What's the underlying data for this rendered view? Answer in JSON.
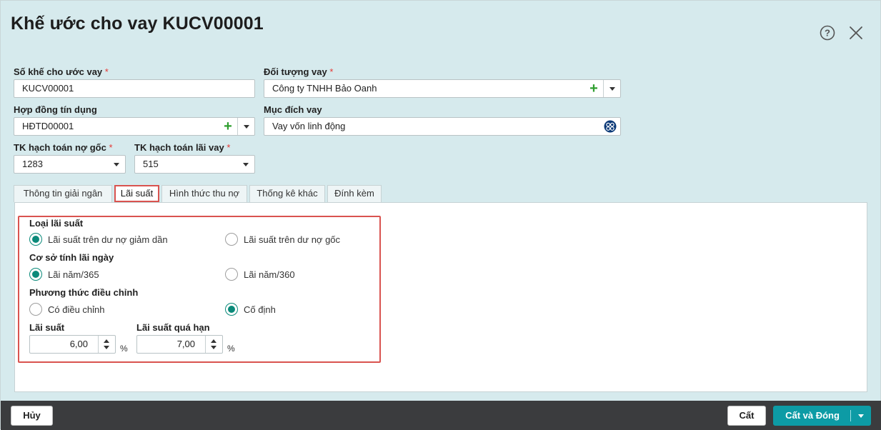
{
  "dialog": {
    "title": "Khế ước cho vay KUCV00001"
  },
  "form": {
    "so_khe_uoc": {
      "label": "Số khế cho ước vay",
      "required": "*",
      "value": "KUCV00001"
    },
    "doi_tuong_vay": {
      "label": "Đối tượng vay",
      "required": "*",
      "value": "Công ty TNHH Bảo Oanh",
      "add_glyph": "+"
    },
    "hop_dong_tin_dung": {
      "label": "Hợp đồng tín dụng",
      "value": "HĐTD00001",
      "add_glyph": "+"
    },
    "muc_dich_vay": {
      "label": "Mục đích vay",
      "value": "Vay vốn linh động"
    },
    "tk_no_goc": {
      "label": "TK hạch toán nợ gốc",
      "required": "*",
      "value": "1283"
    },
    "tk_lai_vay": {
      "label": "TK hạch toán lãi vay",
      "required": "*",
      "value": "515"
    }
  },
  "tabs": [
    {
      "label": "Thông tin giải ngân"
    },
    {
      "label": "Lãi suất"
    },
    {
      "label": "Hình thức thu nợ"
    },
    {
      "label": "Thống kê khác"
    },
    {
      "label": "Đính kèm"
    }
  ],
  "active_tab": "Lãi suất",
  "interest": {
    "loai_lai_suat": {
      "label": "Loại lãi suất",
      "options": [
        "Lãi suất trên dư nợ giảm dần",
        "Lãi suất trên dư nợ gốc"
      ],
      "selected": "Lãi suất trên dư nợ giảm dần"
    },
    "co_so_tinh_lai": {
      "label": "Cơ sở tính lãi ngày",
      "options": [
        "Lãi năm/365",
        "Lãi năm/360"
      ],
      "selected": "Lãi năm/365"
    },
    "phuong_thuc_dieu_chinh": {
      "label": "Phương thức điều chỉnh",
      "options": [
        "Có điều chỉnh",
        "Cố định"
      ],
      "selected": "Cố định"
    },
    "lai_suat": {
      "label": "Lãi suất",
      "value": "6,00",
      "unit": "%"
    },
    "lai_suat_qua_han": {
      "label": "Lãi suất quá hạn",
      "value": "7,00",
      "unit": "%"
    }
  },
  "footer": {
    "cancel_label": "Hủy",
    "save_label": "Cất",
    "save_close_label": "Cất và Đóng"
  },
  "colors": {
    "dialog_bg": "#d6eaed",
    "accent": "#0d9ba5",
    "radio_on": "#0b8a7a",
    "highlight": "#d9534f",
    "required": "#e53935",
    "add_green": "#2e9e2e",
    "footer_bg": "#3b3c3e"
  },
  "icons": {
    "help": "question-circle-icon",
    "close": "close-x-icon",
    "purpose_picker": "globe-search-icon"
  }
}
